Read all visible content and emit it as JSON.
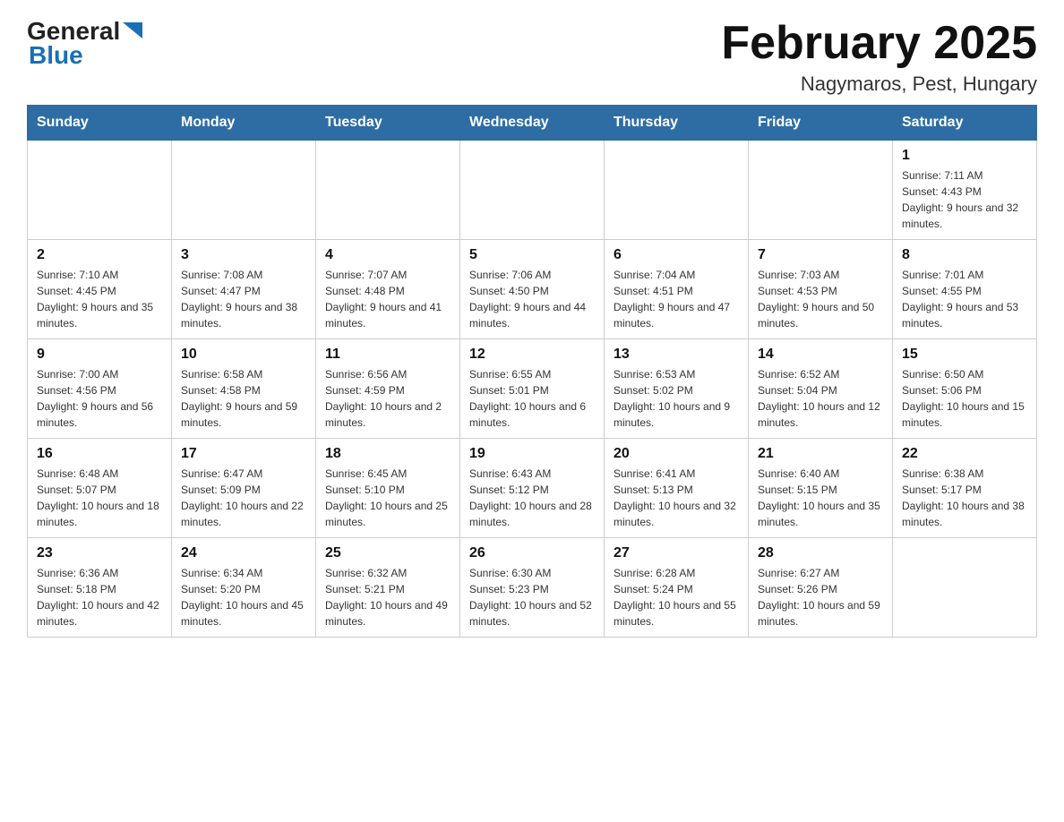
{
  "header": {
    "logo_general": "General",
    "logo_blue": "Blue",
    "title": "February 2025",
    "subtitle": "Nagymaros, Pest, Hungary"
  },
  "days_of_week": [
    "Sunday",
    "Monday",
    "Tuesday",
    "Wednesday",
    "Thursday",
    "Friday",
    "Saturday"
  ],
  "weeks": [
    [
      {
        "day": "",
        "info": ""
      },
      {
        "day": "",
        "info": ""
      },
      {
        "day": "",
        "info": ""
      },
      {
        "day": "",
        "info": ""
      },
      {
        "day": "",
        "info": ""
      },
      {
        "day": "",
        "info": ""
      },
      {
        "day": "1",
        "info": "Sunrise: 7:11 AM\nSunset: 4:43 PM\nDaylight: 9 hours and 32 minutes."
      }
    ],
    [
      {
        "day": "2",
        "info": "Sunrise: 7:10 AM\nSunset: 4:45 PM\nDaylight: 9 hours and 35 minutes."
      },
      {
        "day": "3",
        "info": "Sunrise: 7:08 AM\nSunset: 4:47 PM\nDaylight: 9 hours and 38 minutes."
      },
      {
        "day": "4",
        "info": "Sunrise: 7:07 AM\nSunset: 4:48 PM\nDaylight: 9 hours and 41 minutes."
      },
      {
        "day": "5",
        "info": "Sunrise: 7:06 AM\nSunset: 4:50 PM\nDaylight: 9 hours and 44 minutes."
      },
      {
        "day": "6",
        "info": "Sunrise: 7:04 AM\nSunset: 4:51 PM\nDaylight: 9 hours and 47 minutes."
      },
      {
        "day": "7",
        "info": "Sunrise: 7:03 AM\nSunset: 4:53 PM\nDaylight: 9 hours and 50 minutes."
      },
      {
        "day": "8",
        "info": "Sunrise: 7:01 AM\nSunset: 4:55 PM\nDaylight: 9 hours and 53 minutes."
      }
    ],
    [
      {
        "day": "9",
        "info": "Sunrise: 7:00 AM\nSunset: 4:56 PM\nDaylight: 9 hours and 56 minutes."
      },
      {
        "day": "10",
        "info": "Sunrise: 6:58 AM\nSunset: 4:58 PM\nDaylight: 9 hours and 59 minutes."
      },
      {
        "day": "11",
        "info": "Sunrise: 6:56 AM\nSunset: 4:59 PM\nDaylight: 10 hours and 2 minutes."
      },
      {
        "day": "12",
        "info": "Sunrise: 6:55 AM\nSunset: 5:01 PM\nDaylight: 10 hours and 6 minutes."
      },
      {
        "day": "13",
        "info": "Sunrise: 6:53 AM\nSunset: 5:02 PM\nDaylight: 10 hours and 9 minutes."
      },
      {
        "day": "14",
        "info": "Sunrise: 6:52 AM\nSunset: 5:04 PM\nDaylight: 10 hours and 12 minutes."
      },
      {
        "day": "15",
        "info": "Sunrise: 6:50 AM\nSunset: 5:06 PM\nDaylight: 10 hours and 15 minutes."
      }
    ],
    [
      {
        "day": "16",
        "info": "Sunrise: 6:48 AM\nSunset: 5:07 PM\nDaylight: 10 hours and 18 minutes."
      },
      {
        "day": "17",
        "info": "Sunrise: 6:47 AM\nSunset: 5:09 PM\nDaylight: 10 hours and 22 minutes."
      },
      {
        "day": "18",
        "info": "Sunrise: 6:45 AM\nSunset: 5:10 PM\nDaylight: 10 hours and 25 minutes."
      },
      {
        "day": "19",
        "info": "Sunrise: 6:43 AM\nSunset: 5:12 PM\nDaylight: 10 hours and 28 minutes."
      },
      {
        "day": "20",
        "info": "Sunrise: 6:41 AM\nSunset: 5:13 PM\nDaylight: 10 hours and 32 minutes."
      },
      {
        "day": "21",
        "info": "Sunrise: 6:40 AM\nSunset: 5:15 PM\nDaylight: 10 hours and 35 minutes."
      },
      {
        "day": "22",
        "info": "Sunrise: 6:38 AM\nSunset: 5:17 PM\nDaylight: 10 hours and 38 minutes."
      }
    ],
    [
      {
        "day": "23",
        "info": "Sunrise: 6:36 AM\nSunset: 5:18 PM\nDaylight: 10 hours and 42 minutes."
      },
      {
        "day": "24",
        "info": "Sunrise: 6:34 AM\nSunset: 5:20 PM\nDaylight: 10 hours and 45 minutes."
      },
      {
        "day": "25",
        "info": "Sunrise: 6:32 AM\nSunset: 5:21 PM\nDaylight: 10 hours and 49 minutes."
      },
      {
        "day": "26",
        "info": "Sunrise: 6:30 AM\nSunset: 5:23 PM\nDaylight: 10 hours and 52 minutes."
      },
      {
        "day": "27",
        "info": "Sunrise: 6:28 AM\nSunset: 5:24 PM\nDaylight: 10 hours and 55 minutes."
      },
      {
        "day": "28",
        "info": "Sunrise: 6:27 AM\nSunset: 5:26 PM\nDaylight: 10 hours and 59 minutes."
      },
      {
        "day": "",
        "info": ""
      }
    ]
  ]
}
